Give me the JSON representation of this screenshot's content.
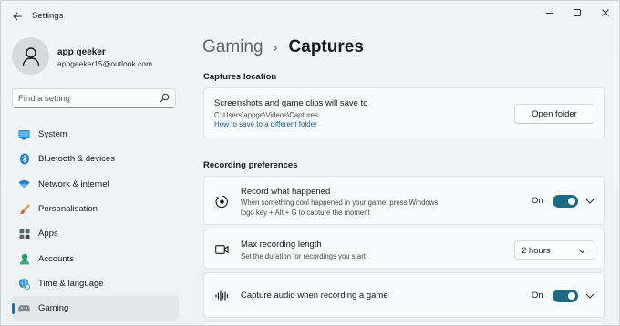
{
  "window": {
    "title": "Settings"
  },
  "profile": {
    "name": "app geeker",
    "email": "appgeeker15@outlook.com"
  },
  "search": {
    "placeholder": "Find a setting"
  },
  "nav": {
    "items": [
      {
        "label": "System",
        "icon": "monitor-icon"
      },
      {
        "label": "Bluetooth & devices",
        "icon": "bluetooth-icon"
      },
      {
        "label": "Network & internet",
        "icon": "wifi-icon"
      },
      {
        "label": "Personalisation",
        "icon": "brush-icon"
      },
      {
        "label": "Apps",
        "icon": "apps-icon"
      },
      {
        "label": "Accounts",
        "icon": "account-icon"
      },
      {
        "label": "Time & language",
        "icon": "globe-clock-icon"
      },
      {
        "label": "Gaming",
        "icon": "gamepad-icon",
        "active": true
      }
    ]
  },
  "breadcrumb": {
    "parent": "Gaming",
    "separator": "›",
    "current": "Captures"
  },
  "captures_location": {
    "section_title": "Captures location",
    "title": "Screenshots and game clips will save to",
    "path": "C:\\Users\\appge\\Videos\\Captures",
    "link": "How to save to a different folder",
    "button": "Open folder"
  },
  "recording_preferences": {
    "section_title": "Recording preferences",
    "record_what_happened": {
      "title": "Record what happened",
      "description_line1": "When something cool happened in your game, press Windows",
      "description_line2": "logo key + Alt + G to capture the moment",
      "state_label": "On",
      "enabled": true
    },
    "max_recording_length": {
      "title": "Max recording length",
      "description": "Set the duration for recordings you start",
      "value": "2 hours"
    },
    "capture_audio": {
      "title": "Capture audio when recording a game",
      "state_label": "On",
      "enabled": true
    }
  },
  "colors": {
    "accent": "#1d6b82",
    "active_indicator": "#1a6fb0",
    "link": "#1a5a8c"
  }
}
